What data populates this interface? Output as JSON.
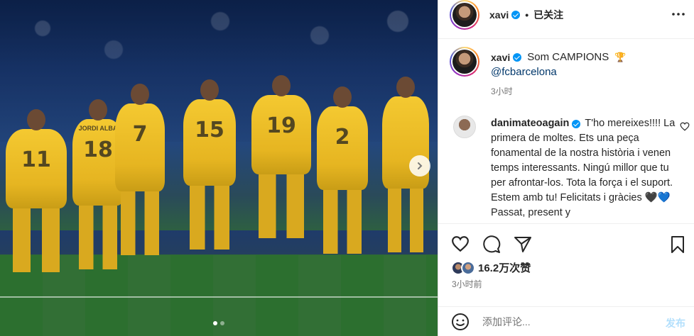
{
  "header": {
    "username": "xavi",
    "separator": "•",
    "follow_status": "已关注",
    "more_icon": "more-horizontal-icon"
  },
  "caption": {
    "username": "xavi",
    "text": "Som CAMPIONS",
    "emoji": "🏆",
    "mention": "@fcbarcelona",
    "time": "3小时"
  },
  "comment": {
    "username": "danimateoagain",
    "text": "T'ho mereixes!!!! La primera de moltes. Ets una peça fonamental de la nostra història i venen temps interessants. Ningú millor que tu per afrontar-los. Tota la força i el suport. Estem amb tu! Felicitats i gràcies 🖤💙 Passat, present y"
  },
  "actions": {
    "likes": "16.2万次赞",
    "post_time": "3小时前"
  },
  "add_comment": {
    "placeholder": "添加评论...",
    "post_label": "发布"
  },
  "media": {
    "jerseys": [
      {
        "name": "",
        "num": "11"
      },
      {
        "name": "JORDI ALBA",
        "num": "18"
      },
      {
        "name": "",
        "num": "7"
      },
      {
        "name": "",
        "num": "15"
      },
      {
        "name": "",
        "num": "19"
      },
      {
        "name": "",
        "num": "2"
      }
    ],
    "carousel_dots": 2,
    "active_dot": 1
  },
  "colors": {
    "link": "#00376b",
    "verified": "#0095f6",
    "muted": "#737373",
    "post_button": "#b2dffc"
  }
}
